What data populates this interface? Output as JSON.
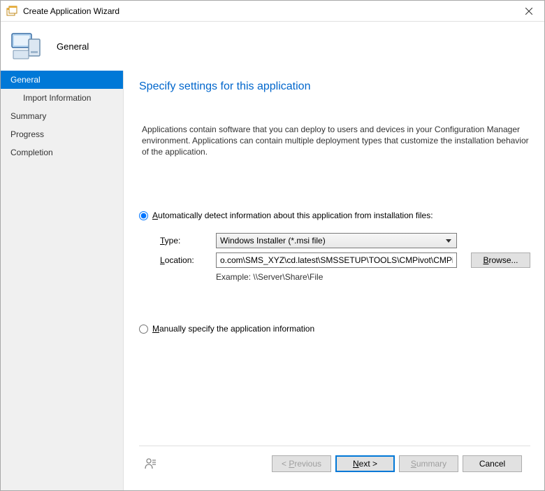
{
  "window": {
    "title": "Create Application Wizard"
  },
  "header": {
    "stepTitle": "General"
  },
  "sidebar": {
    "items": [
      {
        "label": "General",
        "selected": true,
        "indent": false
      },
      {
        "label": "Import Information",
        "selected": false,
        "indent": true
      },
      {
        "label": "Summary",
        "selected": false,
        "indent": false
      },
      {
        "label": "Progress",
        "selected": false,
        "indent": false
      },
      {
        "label": "Completion",
        "selected": false,
        "indent": false
      }
    ]
  },
  "content": {
    "heading": "Specify settings for this application",
    "description": "Applications contain software that you can deploy to users and devices in your Configuration Manager environment. Applications can contain multiple deployment types that customize the installation behavior of the application.",
    "optionAuto": {
      "prefix": "A",
      "rest": "utomatically detect information about this application from installation files:",
      "checked": true
    },
    "typeLabel": {
      "prefix": "T",
      "rest": "ype:"
    },
    "typeValue": "Windows Installer (*.msi file)",
    "locationLabel": {
      "prefix": "L",
      "rest": "ocation:"
    },
    "locationValue": "o.com\\SMS_XYZ\\cd.latest\\SMSSETUP\\TOOLS\\CMPivot\\CMPivot.msi",
    "browseLabel": {
      "prefix": "B",
      "rest": "rowse..."
    },
    "exampleLabel": "Example: \\\\Server\\Share\\File",
    "optionManual": {
      "prefix": "M",
      "rest": "anually specify the application information",
      "checked": false
    }
  },
  "footer": {
    "previous": {
      "prefix": "P",
      "rest": "revious",
      "text": "< Previous"
    },
    "next": {
      "prefix": "N",
      "rest": "ext >"
    },
    "summary": {
      "prefix": "S",
      "rest": "ummary"
    },
    "cancel": "Cancel"
  }
}
